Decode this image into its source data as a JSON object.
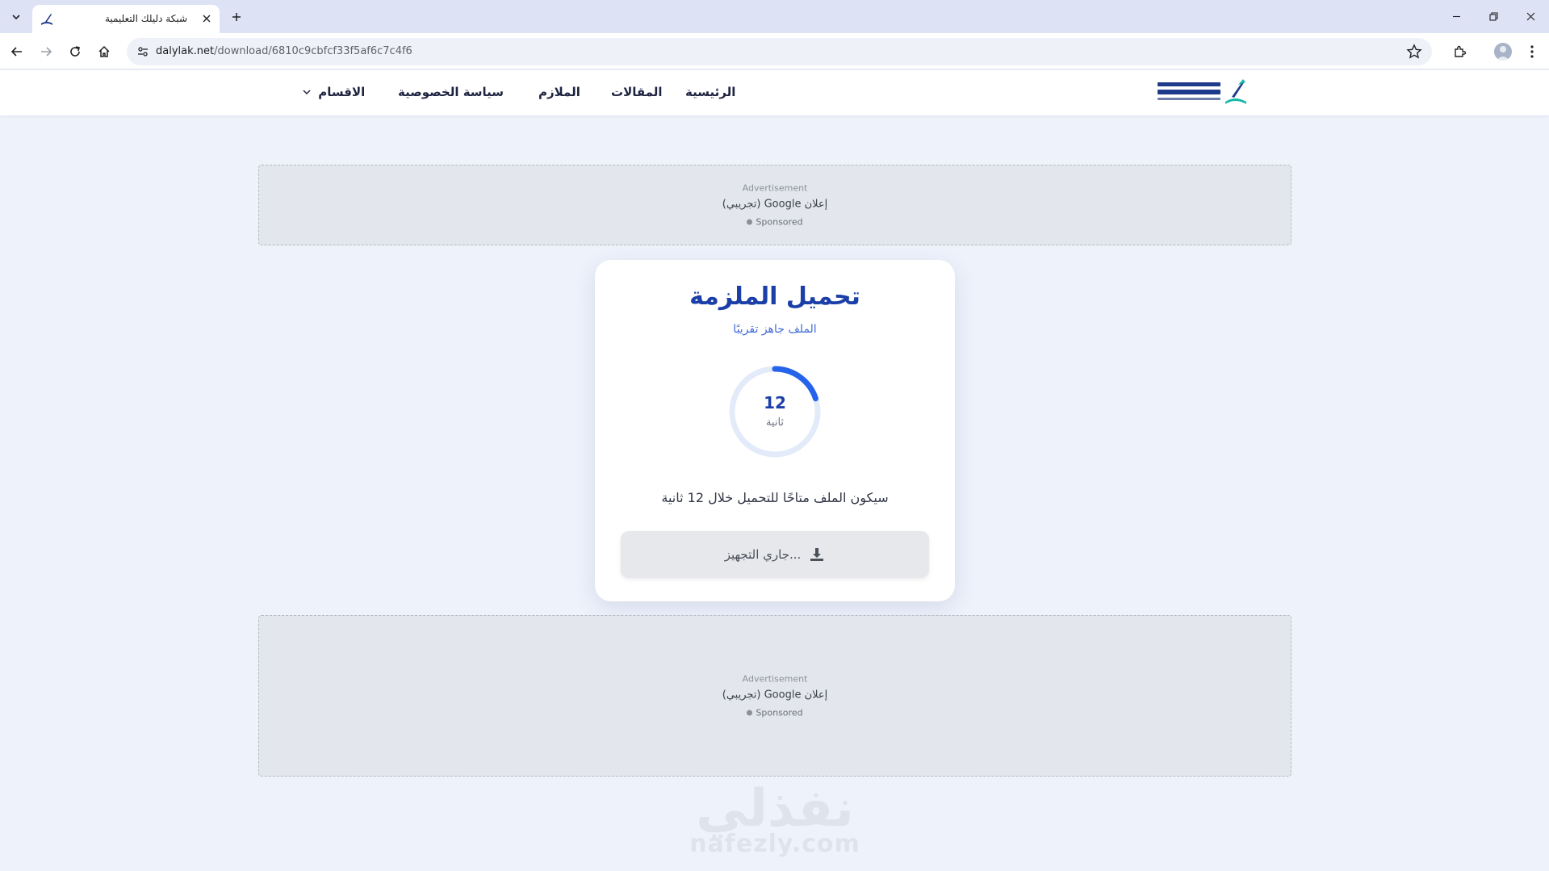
{
  "browser": {
    "tab": {
      "title": "شبكة دليلك التعليمية"
    },
    "address": {
      "domain": "dalylak.net",
      "path": "/download/6810c9cbfcf33f5af6c7c4f6"
    }
  },
  "header": {
    "nav": {
      "home": "الرئيسية",
      "articles": "المقالات",
      "booklets": "الملازم",
      "privacy": "سياسة الخصوصية",
      "sections": "الاقسام"
    }
  },
  "ads": {
    "top": {
      "label": "Advertisement",
      "text": "إعلان Google (تجريبي)",
      "sponsored": "Sponsored"
    },
    "bottom": {
      "label": "Advertisement",
      "text": "إعلان Google (تجريبي)",
      "sponsored": "Sponsored"
    }
  },
  "download": {
    "title": "تحميل الملزمة",
    "subtitle": "الملف جاهز تقريبًا",
    "countdown": "12",
    "countdown_unit": "ثانية",
    "countdown_progress": 0.2,
    "info": "سيكون الملف متاحًا للتحميل خلال 12 ثانية",
    "button_label": "جاري التجهيز..."
  },
  "watermark": {
    "arabic": "نفذلي",
    "latin": "nafezly.com"
  },
  "colors": {
    "accent": "#1b3fa8",
    "ring_progress": "#2563eb",
    "ring_track": "#e3ebfa"
  },
  "icons": [
    "chevron-down-icon",
    "close-icon",
    "plus-icon",
    "back-icon",
    "forward-icon",
    "reload-icon",
    "home-icon",
    "site-info-icon",
    "star-icon",
    "extensions-icon",
    "menu-icon",
    "download-icon"
  ]
}
